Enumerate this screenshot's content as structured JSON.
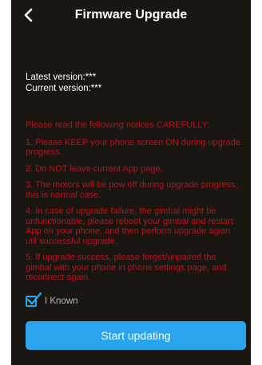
{
  "header": {
    "title": "Firmware Upgrade",
    "back_icon": "chevron-left-icon"
  },
  "versions": {
    "latest": "Latest version:***",
    "current": "Current version:***"
  },
  "notices": {
    "lead": "Please read the following notices CAREFULLY:",
    "items": [
      "1. Please KEEP your phone screen ON during upgrade progress.",
      "2. Do NOT leave current App page.",
      "3. The motors will be pow off during upgrade progress, this is normal case.",
      "4. In case of upgrade failure, the gimbal might be unfunctionable,  please reboot your gimbal and restart App on your phone, and then perform upgrade agian util successful upgrade.",
      "5. If upgrade success, please forget/unpaired the gimbal with your phone in phone settings page, and reconnect again."
    ]
  },
  "agree": {
    "label": "I Known",
    "checked": true
  },
  "start_button": {
    "label": "Start updating"
  },
  "colors": {
    "background": "#1a1612",
    "accent": "#2aa4ec",
    "warning_text": "#b3141d"
  }
}
